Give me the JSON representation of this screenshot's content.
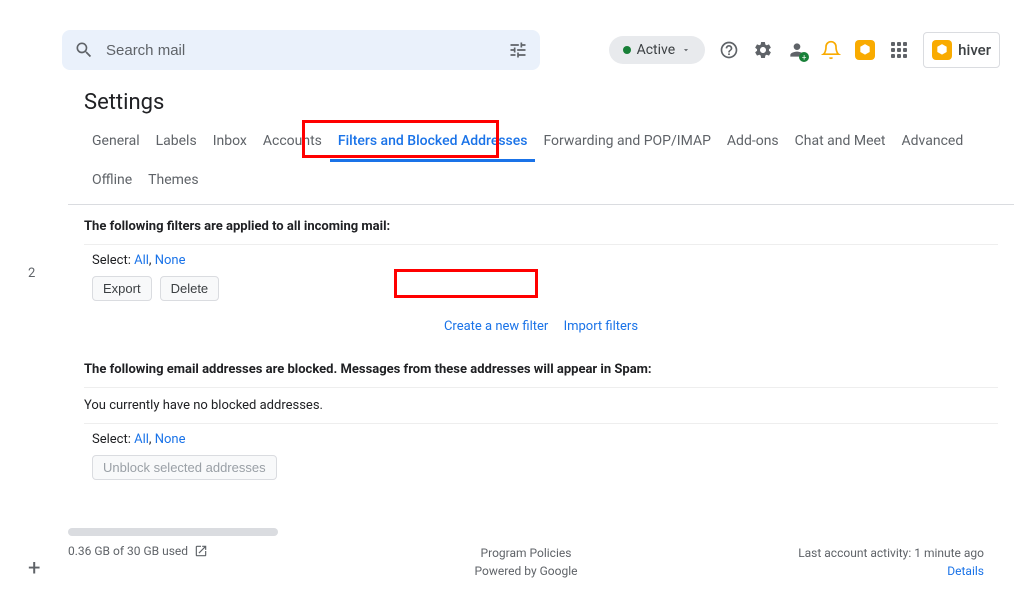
{
  "search": {
    "placeholder": "Search mail"
  },
  "status": {
    "label": "Active"
  },
  "hiver": {
    "label": "hiver"
  },
  "sidebar": {
    "number": "2",
    "plus": "+"
  },
  "title": "Settings",
  "tabs": [
    {
      "label": "General"
    },
    {
      "label": "Labels"
    },
    {
      "label": "Inbox"
    },
    {
      "label": "Accounts"
    },
    {
      "label": "Filters and Blocked Addresses",
      "active": true
    },
    {
      "label": "Forwarding and POP/IMAP"
    },
    {
      "label": "Add-ons"
    },
    {
      "label": "Chat and Meet"
    },
    {
      "label": "Advanced"
    },
    {
      "label": "Offline"
    },
    {
      "label": "Themes"
    }
  ],
  "filters": {
    "heading": "The following filters are applied to all incoming mail:",
    "select_label": "Select:",
    "select_all": "All",
    "select_none": "None",
    "export_btn": "Export",
    "delete_btn": "Delete",
    "create_link": "Create a new filter",
    "import_link": "Import filters"
  },
  "blocked": {
    "heading": "The following email addresses are blocked. Messages from these addresses will appear in Spam:",
    "empty_text": "You currently have no blocked addresses.",
    "select_label": "Select:",
    "select_all": "All",
    "select_none": "None",
    "unblock_btn": "Unblock selected addresses"
  },
  "footer": {
    "storage": "0.36 GB of 30 GB used",
    "policies": "Program Policies",
    "powered": "Powered by Google",
    "activity": "Last account activity: 1 minute ago",
    "details": "Details"
  }
}
